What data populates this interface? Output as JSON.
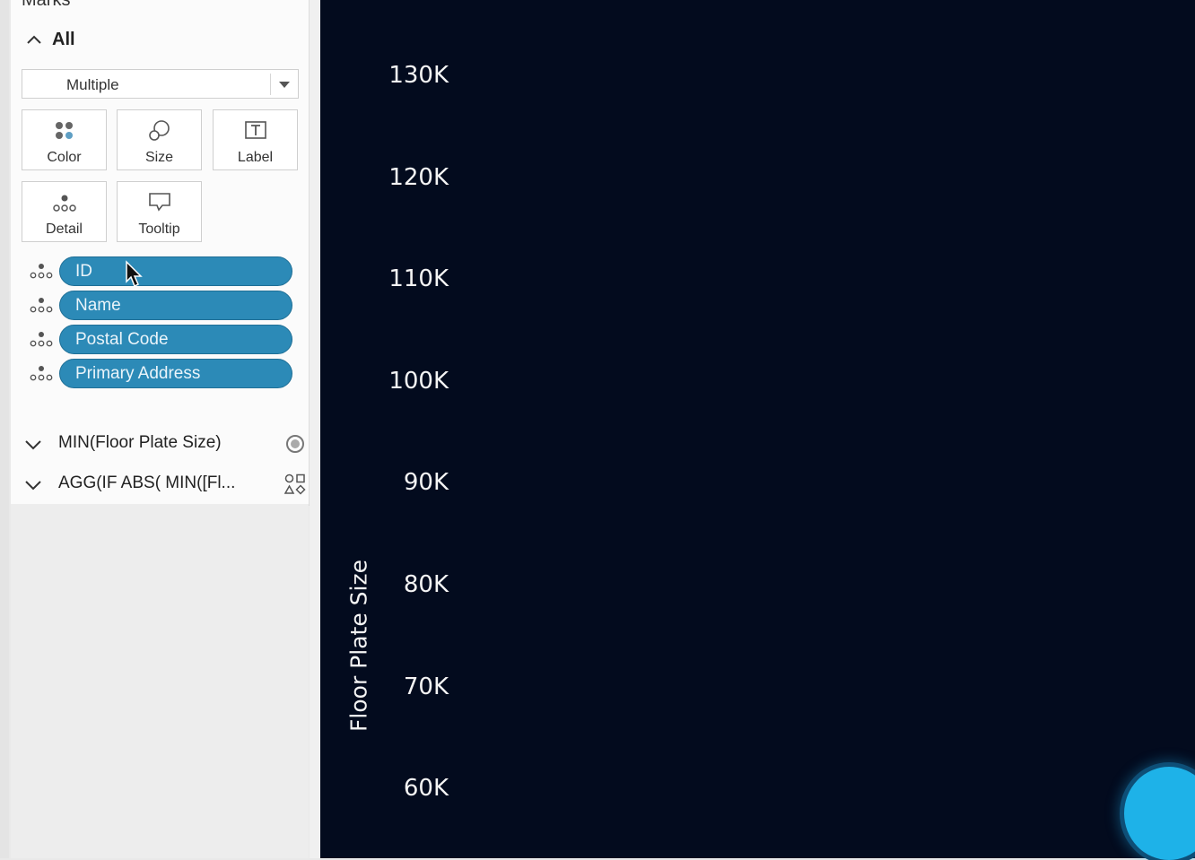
{
  "marks": {
    "header": "Marks",
    "all_label": "All",
    "mark_type": "Multiple",
    "cards": [
      {
        "label": "Color",
        "icon": "color-dots-icon"
      },
      {
        "label": "Size",
        "icon": "size-shapes-icon"
      },
      {
        "label": "Label",
        "icon": "label-text-icon"
      },
      {
        "label": "Detail",
        "icon": "detail-dots-icon"
      },
      {
        "label": "Tooltip",
        "icon": "tooltip-bubble-icon"
      }
    ],
    "pills": [
      {
        "label": "ID",
        "icon": "detail-dots-icon"
      },
      {
        "label": "Name",
        "icon": "detail-dots-icon"
      },
      {
        "label": "Postal Code",
        "icon": "detail-dots-icon"
      },
      {
        "label": "Primary Address",
        "icon": "detail-dots-icon"
      }
    ],
    "fields": [
      {
        "label": "MIN(Floor Plate Size)",
        "icon": "circle-mark-icon"
      },
      {
        "label": "AGG(IF ABS( MIN([Fl...",
        "icon": "shapes-mark-icon"
      }
    ],
    "pill_color": "#2c8ab7"
  },
  "chart_data": {
    "type": "scatter",
    "ylabel": "Floor Plate Size",
    "yticks": [
      "130K",
      "120K",
      "110K",
      "100K",
      "90K",
      "80K",
      "70K",
      "60K"
    ],
    "ylim": [
      60000,
      130000
    ],
    "background": "#030b1e",
    "series": []
  },
  "colors": {
    "fab": "#1eb2e8"
  }
}
